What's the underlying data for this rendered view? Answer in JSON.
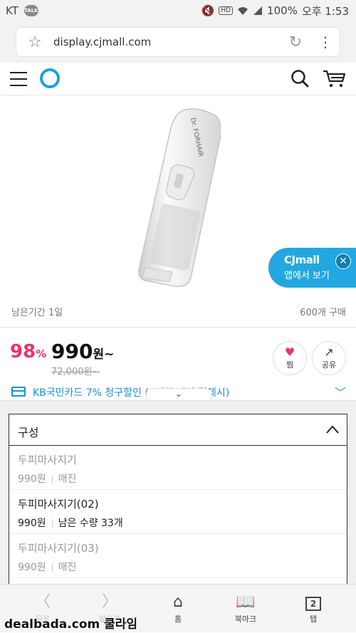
{
  "status_bar": {
    "carrier": "KT",
    "talk_badge": "TALK",
    "battery": "100%",
    "time": "오후 1:53",
    "hd": "HD"
  },
  "browser": {
    "url": "display.cjmall.com"
  },
  "app_banner": {
    "brand": "CJmall",
    "subtitle": "앱에서 보기"
  },
  "product": {
    "remaining_period": "남은기간 1일",
    "purchase_count": "600개 구매",
    "discount": "98",
    "discount_unit": "%",
    "price": "990",
    "price_unit": "원~",
    "original_price": "72,000원~",
    "wish_label": "찜",
    "share_label": "공유",
    "device_brand": "Dr. FORHAIR"
  },
  "promo": {
    "text": "KB국민카드 7% 청구할인 (5만원 이상 결제시)"
  },
  "options": {
    "header": "구성",
    "items": [
      {
        "name": "두피마사지기",
        "price": "990원",
        "status": "매진",
        "sold_out": true
      },
      {
        "name": "두피마사지기(02)",
        "price": "990원",
        "status": "남은 수량 33개",
        "sold_out": false
      },
      {
        "name": "두피마사지기(03)",
        "price": "990원",
        "status": "매진",
        "sold_out": true
      }
    ]
  },
  "bottom_nav": {
    "back": "뒤로",
    "forward": "앞으로",
    "home": "홈",
    "bookmarks": "북마크",
    "tabs": "탭",
    "tab_count": "2"
  },
  "watermark": "dealbada.com 쿨라임",
  "colors": {
    "accent_blue": "#23a7e0",
    "discount_pink": "#e8336e",
    "promo_blue": "#1a8fd8"
  }
}
